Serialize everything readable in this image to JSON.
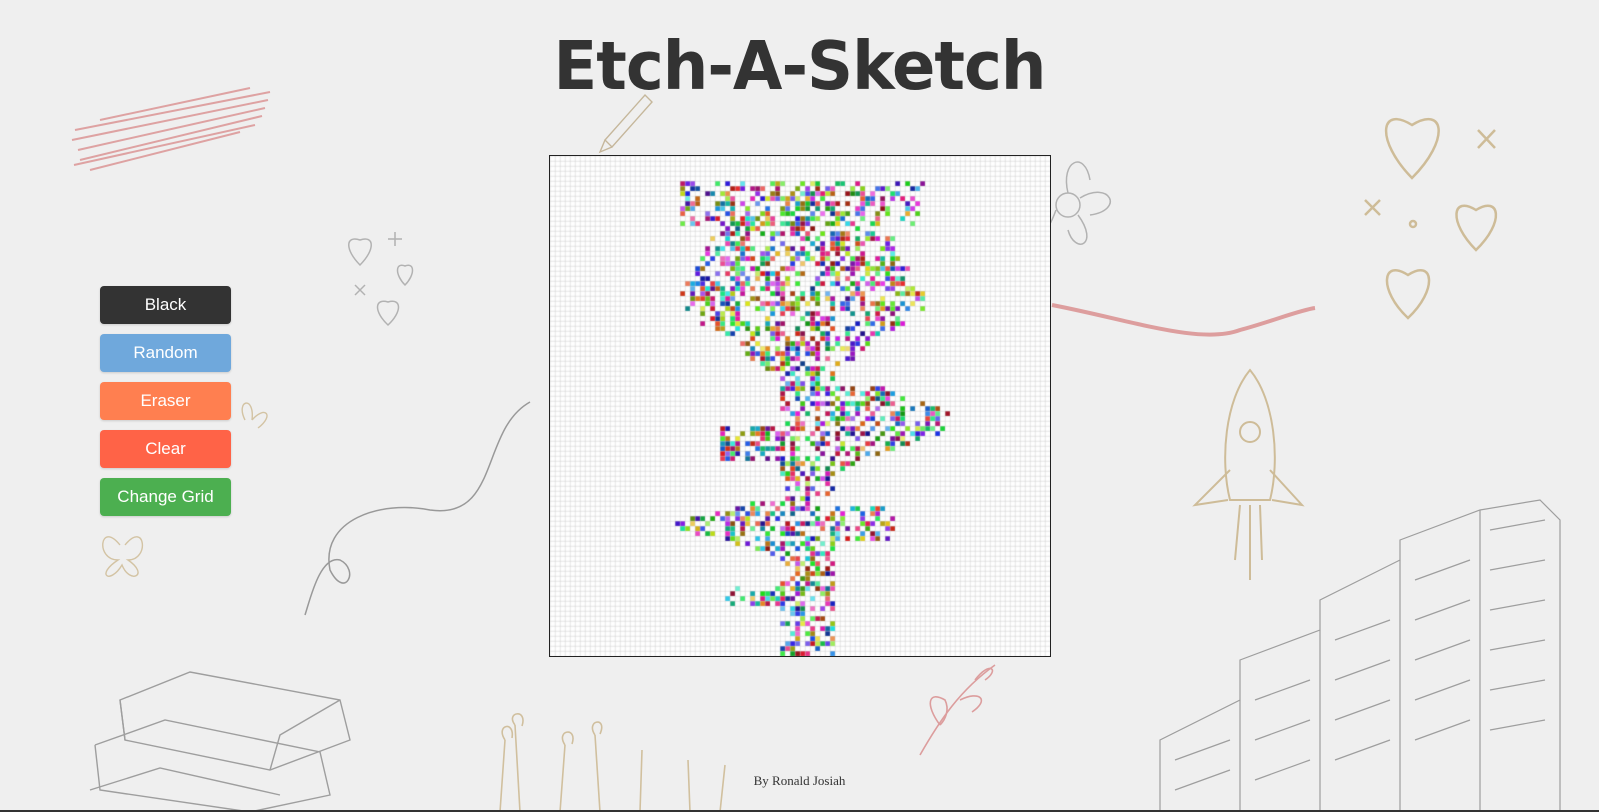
{
  "app": {
    "title": "Etch-A-Sketch",
    "footer": "By Ronald Josiah"
  },
  "controls": {
    "buttons": [
      {
        "label": "Black",
        "color": "#333333"
      },
      {
        "label": "Random",
        "color": "#6fa8dc"
      },
      {
        "label": "Eraser",
        "color": "#ff7f50"
      },
      {
        "label": "Clear",
        "color": "#ff6347"
      },
      {
        "label": "Change Grid",
        "color": "#4caf50"
      }
    ]
  },
  "grid": {
    "cells_per_side": 100,
    "cell_color": "#ffffff",
    "border_color": "#cccccc",
    "drawing": "rose"
  },
  "theme": {
    "background": "#efefef",
    "sketch_pink": "#d98f8f",
    "sketch_beige": "#c9b48a",
    "sketch_gray": "#8a8a8a"
  }
}
